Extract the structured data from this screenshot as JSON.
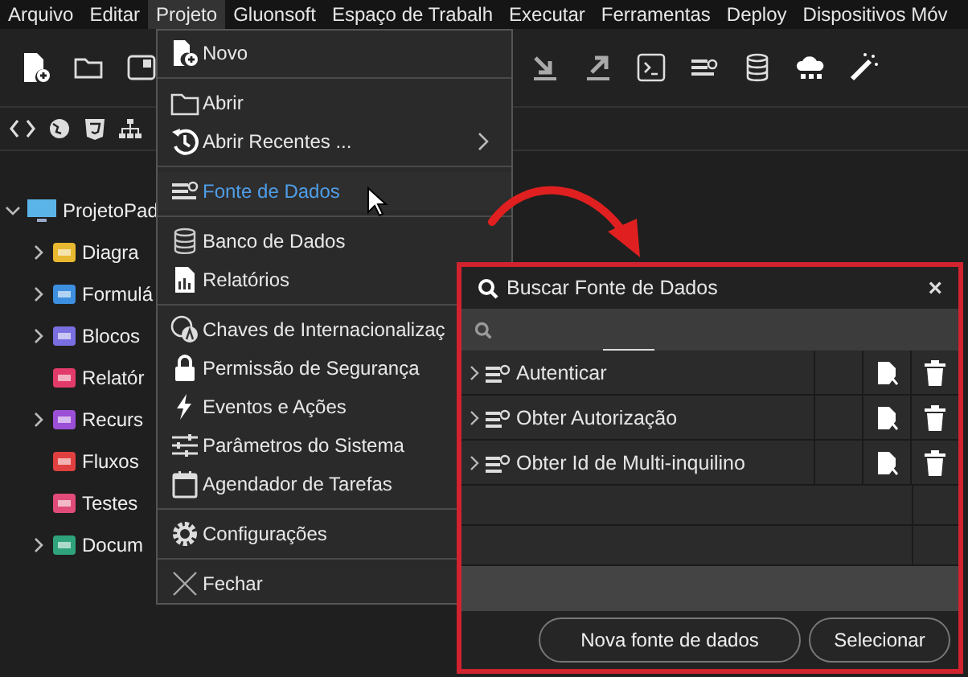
{
  "menubar": [
    {
      "label": "Arquivo",
      "selected": false
    },
    {
      "label": "Editar",
      "selected": false
    },
    {
      "label": "Projeto",
      "selected": true
    },
    {
      "label": "Gluonsoft",
      "selected": false
    },
    {
      "label": "Espaço de Trabalh",
      "selected": false
    },
    {
      "label": "Executar",
      "selected": false
    },
    {
      "label": "Ferramentas",
      "selected": false
    },
    {
      "label": "Deploy",
      "selected": false
    },
    {
      "label": "Dispositivos Móv",
      "selected": false
    }
  ],
  "project_tree": {
    "label": "ProjetoPad",
    "expanded": true,
    "children": [
      {
        "label": "Diagra",
        "expandable": true
      },
      {
        "label": "Formulá",
        "expandable": true
      },
      {
        "label": "Blocos",
        "expandable": true
      },
      {
        "label": "Relatór",
        "expandable": false
      },
      {
        "label": "Recurs",
        "expandable": true
      },
      {
        "label": "Fluxos",
        "expandable": false
      },
      {
        "label": "Testes",
        "expandable": false
      },
      {
        "label": "Docum",
        "expandable": true
      }
    ]
  },
  "project_menu": [
    {
      "kind": "item",
      "label": "Novo",
      "selected": false
    },
    {
      "kind": "divider"
    },
    {
      "kind": "item",
      "label": "Abrir",
      "selected": false
    },
    {
      "kind": "item",
      "label": "Abrir Recentes ...",
      "selected": false,
      "submenu": true
    },
    {
      "kind": "divider"
    },
    {
      "kind": "item",
      "label": "Fonte de Dados",
      "selected": true
    },
    {
      "kind": "divider"
    },
    {
      "kind": "item",
      "label": "Banco de Dados",
      "selected": false
    },
    {
      "kind": "item",
      "label": "Relatórios",
      "selected": false
    },
    {
      "kind": "divider"
    },
    {
      "kind": "item",
      "label": "Chaves de Internacionalizaç",
      "selected": false
    },
    {
      "kind": "item",
      "label": "Permissão de Segurança",
      "selected": false
    },
    {
      "kind": "item",
      "label": "Eventos e Ações",
      "selected": false
    },
    {
      "kind": "item",
      "label": "Parâmetros do Sistema",
      "selected": false
    },
    {
      "kind": "item",
      "label": "Agendador de Tarefas",
      "selected": false
    },
    {
      "kind": "divider"
    },
    {
      "kind": "item",
      "label": "Configurações",
      "selected": false
    },
    {
      "kind": "divider"
    },
    {
      "kind": "item",
      "label": "Fechar",
      "selected": false
    }
  ],
  "dialog": {
    "title": "Buscar Fonte de Dados",
    "close": "×",
    "rows": [
      {
        "name": "Autenticar",
        "expanded": false
      },
      {
        "name": "Obter Autorização",
        "expanded": false
      },
      {
        "name": "Obter Id de Multi-inquilino",
        "expanded": false
      }
    ],
    "buttons": [
      "Nova fonte de dados",
      "Selecionar"
    ]
  }
}
